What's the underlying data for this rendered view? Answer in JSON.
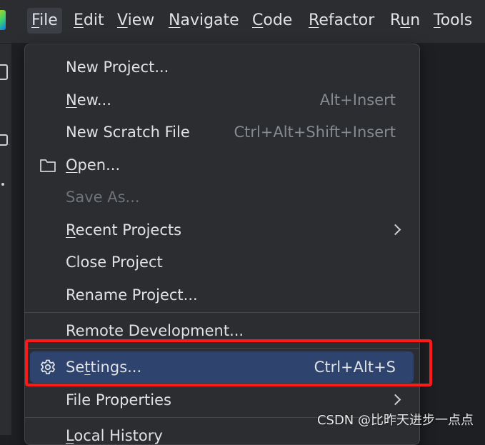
{
  "menubar": {
    "items": [
      {
        "mnemonic": "F",
        "rest": "ile"
      },
      {
        "mnemonic": "E",
        "rest": "dit"
      },
      {
        "mnemonic": "V",
        "rest": "iew"
      },
      {
        "mnemonic": "N",
        "rest": "avigate"
      },
      {
        "mnemonic": "C",
        "rest": "ode"
      },
      {
        "mnemonic": "R",
        "rest": "efactor"
      },
      {
        "pre": "R",
        "mnemonic": "u",
        "rest": "n"
      },
      {
        "mnemonic": "T",
        "rest": "ools"
      }
    ],
    "active_index": 0
  },
  "file_menu": {
    "items": [
      {
        "pre": "New Project...",
        "mnemonic": "",
        "rest": "",
        "shortcut": ""
      },
      {
        "pre": "",
        "mnemonic": "N",
        "rest": "ew...",
        "shortcut": "Alt+Insert"
      },
      {
        "pre": "New Scratch File",
        "mnemonic": "",
        "rest": "",
        "shortcut": "Ctrl+Alt+Shift+Insert"
      },
      {
        "pre": "",
        "mnemonic": "O",
        "rest": "pen...",
        "shortcut": "",
        "icon": "folder-icon"
      },
      {
        "pre": "Save As...",
        "mnemonic": "",
        "rest": "",
        "shortcut": "",
        "disabled": true
      },
      {
        "pre": "",
        "mnemonic": "R",
        "rest": "ecent Projects",
        "shortcut": "",
        "submenu": true
      },
      {
        "pre": "Close Project",
        "mnemonic": "",
        "rest": "",
        "shortcut": ""
      },
      {
        "pre": "Rename Project...",
        "mnemonic": "",
        "rest": "",
        "shortcut": ""
      },
      {
        "pre": "Remote Development...",
        "mnemonic": "",
        "rest": "",
        "shortcut": ""
      },
      {
        "pre": "Se",
        "mnemonic": "t",
        "rest": "tings...",
        "shortcut": "Ctrl+Alt+S",
        "icon": "gear-icon",
        "selected": true
      },
      {
        "pre": "File Properties",
        "mnemonic": "",
        "rest": "",
        "shortcut": "",
        "submenu": true
      },
      {
        "pre": "",
        "mnemonic": "L",
        "rest": "ocal History",
        "shortcut": ""
      }
    ]
  },
  "colors": {
    "menu_bg": "#2b2d30",
    "selection": "#2e436e",
    "highlight_box": "#ff1a1a",
    "text": "#dfe1e5",
    "shortcut_text": "#868a91"
  },
  "watermark": {
    "text": "CSDN @比昨天进步一点点"
  }
}
